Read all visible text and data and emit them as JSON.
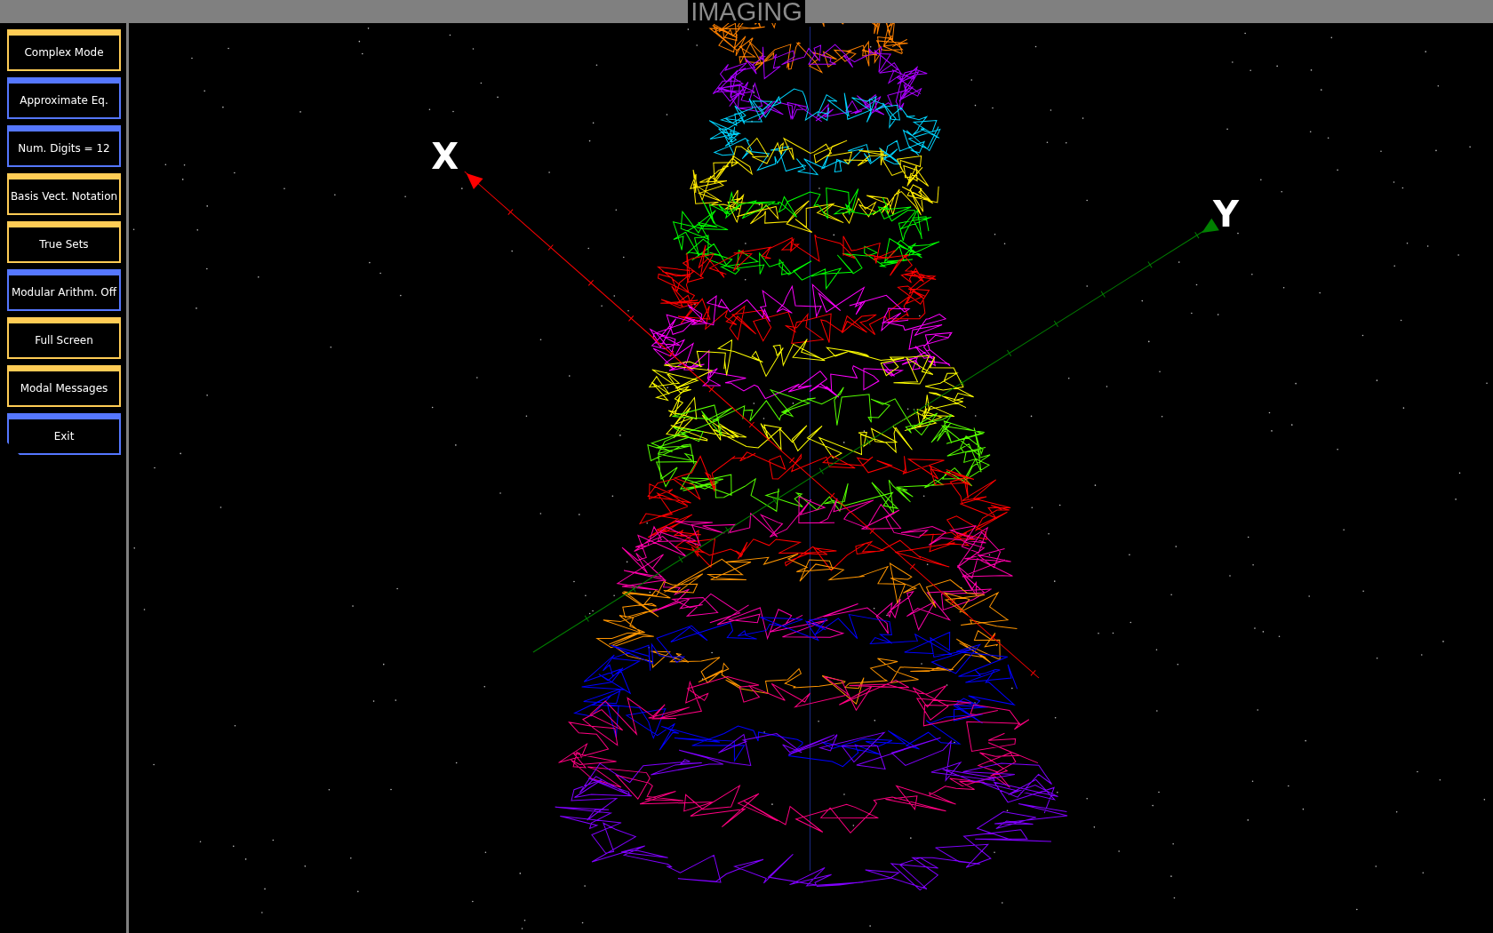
{
  "window": {
    "title": "IMAGING"
  },
  "sidebar": {
    "buttons": [
      {
        "label": "Complex Mode",
        "color": "#ffcc55",
        "kind": "square"
      },
      {
        "label": "Approximate Eq.",
        "color": "#5577ff",
        "kind": "square"
      },
      {
        "label": "Num. Digits = 12",
        "color": "#5577ff",
        "kind": "square"
      },
      {
        "label": "Basis Vect. Notation",
        "color": "#ffcc55",
        "kind": "square"
      },
      {
        "label": "True Sets",
        "color": "#ffcc55",
        "kind": "square"
      },
      {
        "label": "Modular Arithm. Off",
        "color": "#5577ff",
        "kind": "square"
      },
      {
        "label": "Full Screen",
        "color": "#ffcc55",
        "kind": "square"
      },
      {
        "label": "Modal Messages",
        "color": "#ffcc55",
        "kind": "square"
      },
      {
        "label": "Exit",
        "color": "#5577ff",
        "kind": "cut-corner"
      }
    ]
  },
  "scene": {
    "axes": [
      {
        "label": "X",
        "color": "#ff0000"
      },
      {
        "label": "Y",
        "color": "#008000"
      }
    ]
  }
}
